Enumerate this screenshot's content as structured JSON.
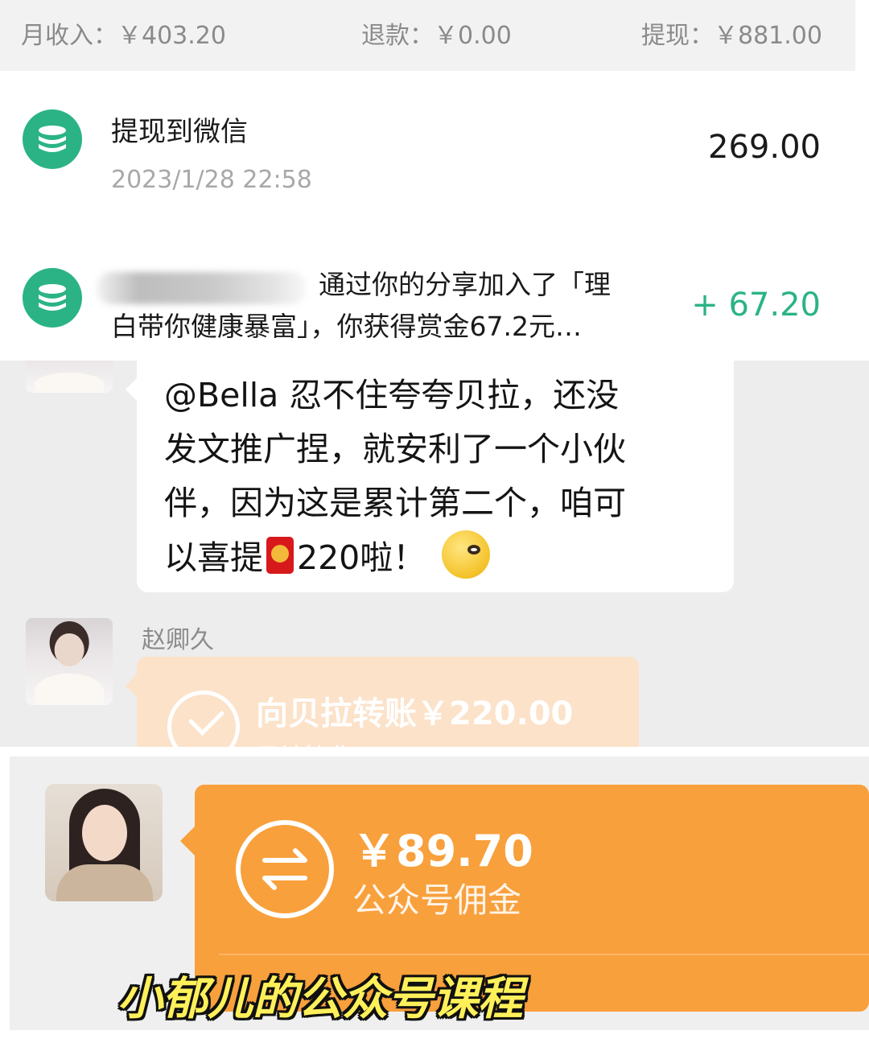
{
  "summary": {
    "income": "月收入：￥403.20",
    "refund": "退款：￥0.00",
    "withdraw": "提现：￥881.00"
  },
  "transactions": [
    {
      "icon": "coins-icon",
      "title": "提现到微信",
      "time": "2023/1/28 22:58",
      "amount": "269.00",
      "amount_color": "#1a1a1a"
    },
    {
      "icon": "coins-icon",
      "desc_line1": "通过你的分享加入了「理",
      "desc_line2": "白带你健康暴富」，你获得赏金67.2元…",
      "amount": "+ 67.20",
      "amount_color": "#2bb386"
    }
  ],
  "chat": {
    "message_lines": [
      "@Bella 忍不住夸夸贝拉，还没",
      "发文推广捏，就安利了一个小伙",
      "伴，因为这是累计第二个，咱可",
      "以喜提",
      "220啦！"
    ],
    "sender_name": "赵卿久",
    "transfer_title": "向贝拉转账￥220.00",
    "transfer_status": "已被接收"
  },
  "payment": {
    "amount": "￥89.70",
    "label": "公众号佣金"
  },
  "caption": "小郁儿的公众号课程",
  "colors": {
    "accent_green": "#2bb386",
    "transfer_orange": "#f8a03c",
    "chat_bg": "#ededed"
  }
}
